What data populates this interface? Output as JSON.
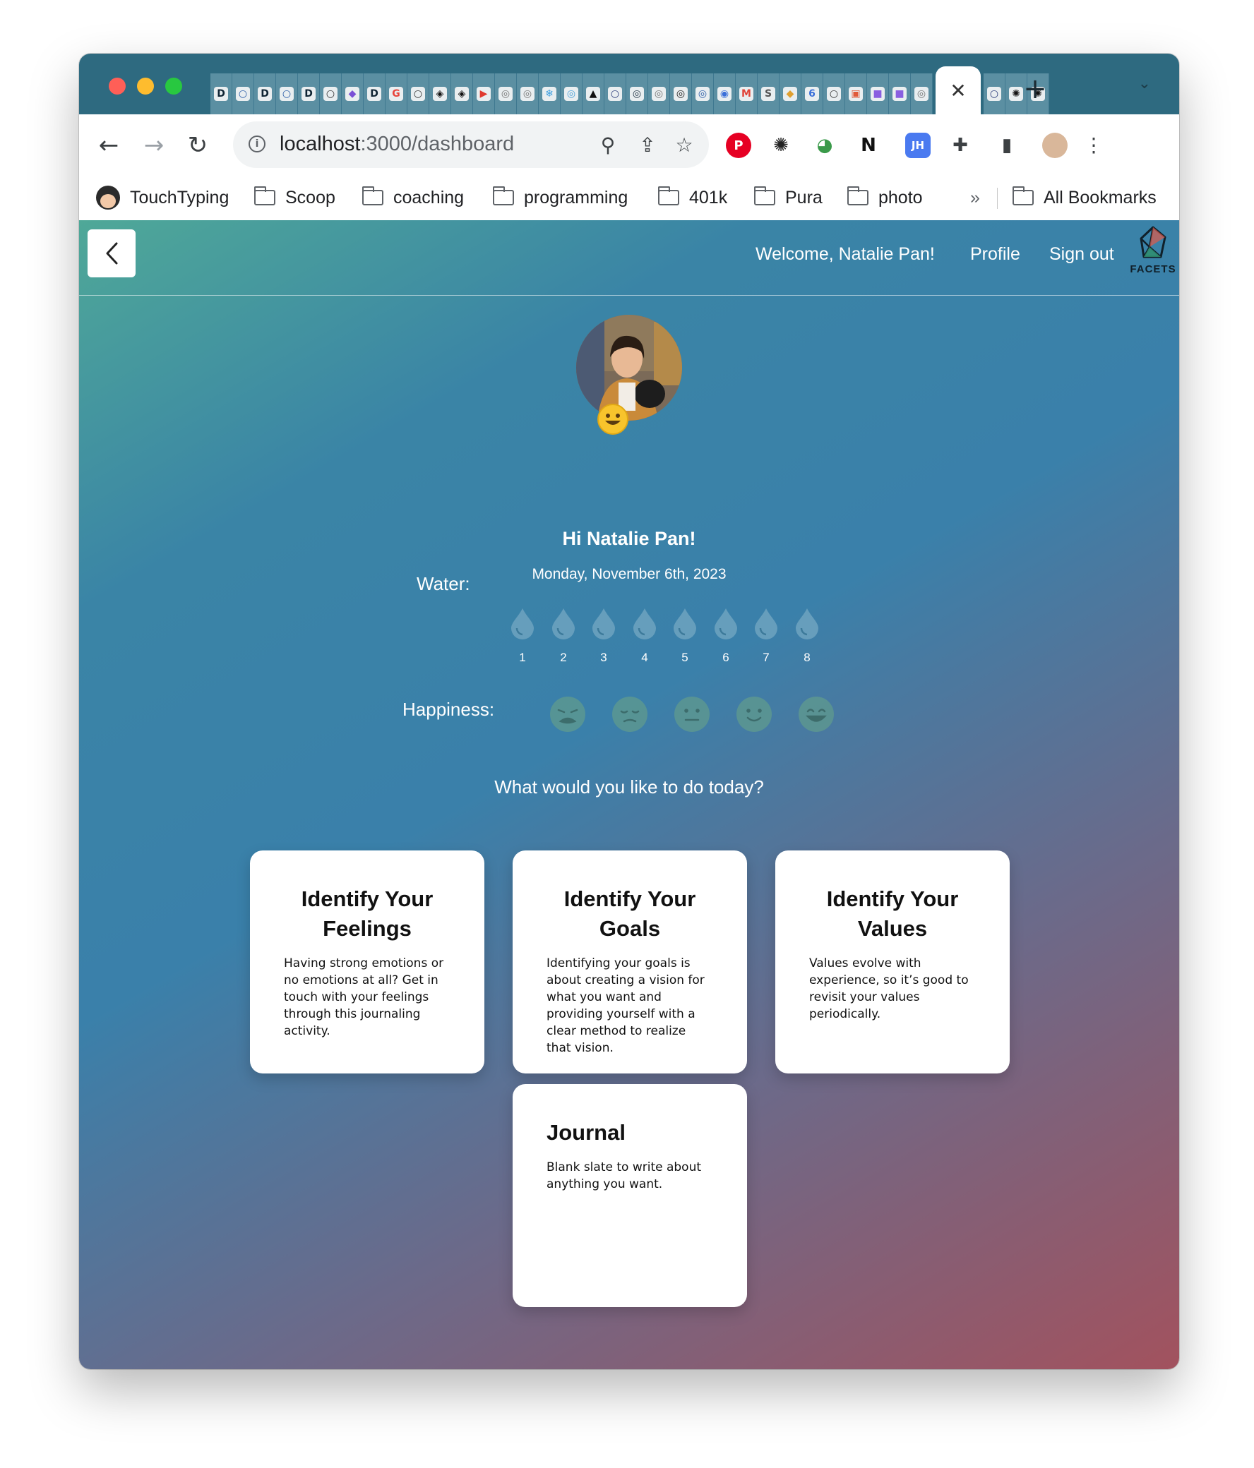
{
  "browser": {
    "tab_favicons": [
      {
        "glyph": "D",
        "color": "#0f2433"
      },
      {
        "glyph": "○",
        "color": "#2d5ea8"
      },
      {
        "glyph": "D",
        "color": "#0f2433"
      },
      {
        "glyph": "○",
        "color": "#2d5ea8"
      },
      {
        "glyph": "D",
        "color": "#0f2433"
      },
      {
        "glyph": "○",
        "color": "#333333"
      },
      {
        "glyph": "◆",
        "color": "#7a4fd6"
      },
      {
        "glyph": "D",
        "color": "#0f2433"
      },
      {
        "glyph": "G",
        "color": "#e8453c"
      },
      {
        "glyph": "○",
        "color": "#333333"
      },
      {
        "glyph": "◈",
        "color": "#111111"
      },
      {
        "glyph": "◈",
        "color": "#111111"
      },
      {
        "glyph": "▶",
        "color": "#e03a2f"
      },
      {
        "glyph": "◎",
        "color": "#777777"
      },
      {
        "glyph": "◎",
        "color": "#777777"
      },
      {
        "glyph": "❄",
        "color": "#3fa0e0"
      },
      {
        "glyph": "◎",
        "color": "#4fa3d9"
      },
      {
        "glyph": "▲",
        "color": "#111111"
      },
      {
        "glyph": "○",
        "color": "#2b3b7a"
      },
      {
        "glyph": "◎",
        "color": "#1f3344"
      },
      {
        "glyph": "◎",
        "color": "#777777"
      },
      {
        "glyph": "◎",
        "color": "#222222"
      },
      {
        "glyph": "◎",
        "color": "#2d5ea8"
      },
      {
        "glyph": "◉",
        "color": "#3a6fd9"
      },
      {
        "glyph": "M",
        "color": "#e0453a"
      },
      {
        "glyph": "S",
        "color": "#555555"
      },
      {
        "glyph": "◆",
        "color": "#e0a030"
      },
      {
        "glyph": "6",
        "color": "#3a6fd9"
      },
      {
        "glyph": "○",
        "color": "#333333"
      },
      {
        "glyph": "▣",
        "color": "#e05a3a"
      },
      {
        "glyph": "■",
        "color": "#8a5fe0"
      },
      {
        "glyph": "■",
        "color": "#8a5fe0"
      },
      {
        "glyph": "◎",
        "color": "#777777"
      }
    ],
    "active_tab_close": "✕",
    "tabs_after": [
      {
        "glyph": "○",
        "color": "#2b3b7a"
      },
      {
        "glyph": "✺",
        "color": "#111111"
      },
      {
        "glyph": "✺",
        "color": "#111111"
      }
    ],
    "new_tab": "+",
    "tab_menu": "⌄",
    "url_host": "localhost",
    "url_path": ":3000/dashboard",
    "icons": {
      "back": "←",
      "forward": "→",
      "reload": "↻",
      "info": "i",
      "zoom": "⚲",
      "share": "⇪",
      "star": "☆",
      "menu": "⋮"
    },
    "extensions": [
      {
        "name": "pinterest-extension-icon",
        "glyph": "P",
        "color": "#e60023"
      },
      {
        "name": "loading-extension-icon",
        "glyph": "✺",
        "color": "#222222"
      },
      {
        "name": "green-extension-icon",
        "glyph": "◕",
        "color": "#3a9a4a"
      },
      {
        "name": "notion-extension-icon",
        "glyph": "N",
        "color": "#111111"
      },
      {
        "name": "megaphone-extension-icon",
        "glyph": "◀",
        "color": "#e0453a"
      },
      {
        "name": "jh-extension-icon",
        "glyph": "JH",
        "color": "#4a7af0"
      },
      {
        "name": "puzzle-extension-icon",
        "glyph": "✚",
        "color": "#3c4043"
      },
      {
        "name": "sidepanel-icon",
        "glyph": "▮",
        "color": "#3c4043"
      }
    ],
    "bookmarks": [
      "TouchTyping",
      "Scoop",
      "coaching",
      "programming",
      "401k",
      "Pura",
      "photo"
    ],
    "bookmarks_more": "»",
    "all_bookmarks": "All Bookmarks"
  },
  "app": {
    "back_glyph": "‹",
    "welcome": "Welcome, Natalie Pan!",
    "profile": "Profile",
    "sign_out": "Sign out",
    "logo_text": "FACETS",
    "greeting": "Hi Natalie Pan!",
    "date": "Monday, November 6th, 2023",
    "water_label": "Water:",
    "water_levels": [
      "1",
      "2",
      "3",
      "4",
      "5",
      "6",
      "7",
      "8"
    ],
    "happiness_label": "Happiness:",
    "happiness_faces": [
      "weary-face-icon",
      "pensive-face-icon",
      "neutral-face-icon",
      "slight-smile-face-icon",
      "grin-face-icon"
    ],
    "question": "What would you like to do today?",
    "cards": [
      {
        "title": "Identify Your Feelings",
        "desc": "Having strong emotions or no emotions at all? Get in touch with your feelings through this journaling activity."
      },
      {
        "title": "Identify Your Goals",
        "desc": "Identifying your goals is about creating a vision for what you want and providing yourself with a clear method to realize that vision."
      },
      {
        "title": "Identify Your Values",
        "desc": "Values evolve with experience, so it’s good to revisit your values periodically."
      },
      {
        "title": "Journal",
        "desc": "Blank slate to write about anything you want."
      }
    ]
  }
}
